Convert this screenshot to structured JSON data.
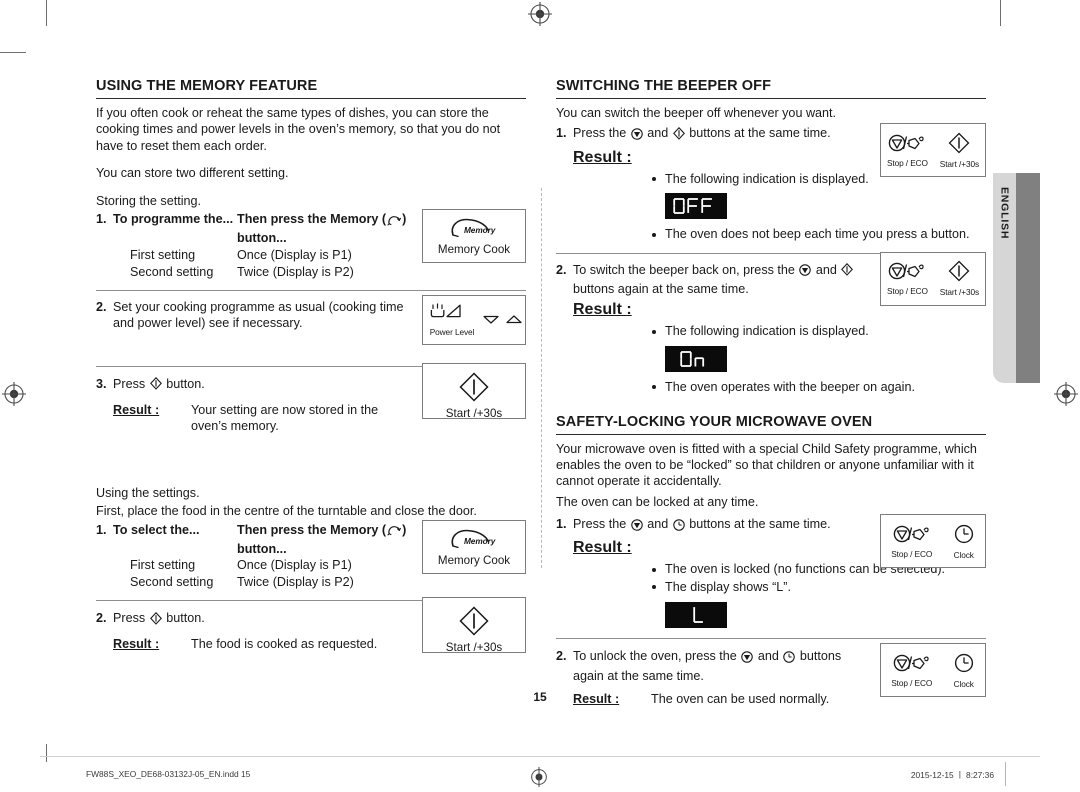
{
  "page": {
    "number": "15",
    "language_tab": "ENGLISH"
  },
  "left_column": {
    "section": {
      "title": "USING THE MEMORY FEATURE",
      "intro_1": "If you often cook or reheat the same types of dishes, you can store the cooking times and power levels in the oven’s memory, so that you do not have to reset them each order.",
      "intro_2": "You can store two different setting."
    },
    "storing": {
      "lead_in": "Storing the setting.",
      "step1": {
        "num": "1.",
        "header_a": "To programme the...",
        "header_b": "Then press the Memory (      ) button...",
        "options": [
          {
            "label": "First setting",
            "action": "Once (Display is P1)"
          },
          {
            "label": "Second setting",
            "action": "Twice (Display is P2)"
          }
        ],
        "keyart": {
          "caption_small": "Memory",
          "caption": "Memory Cook"
        }
      },
      "step2": {
        "num": "2.",
        "text": "Set your cooking programme as usual (cooking time and power level) see if necessary.",
        "keyart": {
          "caption_small": "Power Level"
        }
      },
      "step3": {
        "num": "3.",
        "text_before": "Press",
        "text_after": "button.",
        "result_label": "Result :",
        "result_text": "Your setting are now stored in the oven’s memory.",
        "keyart": {
          "caption": "Start /+30s"
        }
      }
    },
    "using": {
      "lead_in_1": "Using the settings.",
      "lead_in_2": "First, place the food in the centre of the turntable and close the door.",
      "step1": {
        "num": "1.",
        "header_a": "To select the...",
        "header_b": "Then press the Memory (      ) button...",
        "options": [
          {
            "label": "First setting",
            "action": "Once (Display is P1)"
          },
          {
            "label": "Second setting",
            "action": "Twice (Display is P2)"
          }
        ],
        "keyart": {
          "caption_small": "Memory",
          "caption": "Memory Cook"
        }
      },
      "step2": {
        "num": "2.",
        "text_before": "Press",
        "text_after": "button.",
        "result_label": "Result :",
        "result_text": "The food is cooked as requested.",
        "keyart": {
          "caption": "Start /+30s"
        }
      }
    }
  },
  "right_column": {
    "beeper": {
      "title": "SWITCHING THE BEEPER OFF",
      "intro": "You can switch the beeper off whenever you want.",
      "step1": {
        "num": "1.",
        "text_before": "Press the",
        "text_mid": "and",
        "text_after": "buttons at the same time.",
        "result_label": "Result :",
        "bullet_1": "The following indication is displayed.",
        "display_value": "OFF",
        "bullet_2": "The oven does not beep each time you press a button.",
        "keyart": {
          "caption_stop": "Stop / ECO",
          "caption_start": "Start /+30s"
        }
      },
      "step2": {
        "num": "2.",
        "text_before": "To switch the beeper back on, press the",
        "text_mid": "and",
        "text_after": "buttons again at the same time.",
        "result_label": "Result :",
        "bullet_1": "The following indication is displayed.",
        "display_value": "On",
        "bullet_2": "The oven operates with the beeper on again.",
        "keyart": {
          "caption_stop": "Stop / ECO",
          "caption_start": "Start /+30s"
        }
      }
    },
    "safety_lock": {
      "title": "SAFETY-LOCKING YOUR MICROWAVE OVEN",
      "intro_1": "Your microwave oven is fitted with a special Child Safety programme, which enables the oven to be “locked” so that children or anyone unfamiliar with it cannot operate it accidentally.",
      "intro_2": "The oven can be locked at any time.",
      "step1": {
        "num": "1.",
        "text_before": "Press the",
        "text_mid": "and",
        "text_after": "buttons at the same time.",
        "result_label": "Result :",
        "bullet_1": "The oven is locked (no functions can be selected).",
        "bullet_2": "The display shows “L”.",
        "display_value": "L",
        "keyart": {
          "caption_stop": "Stop / ECO",
          "caption_clock": "Clock"
        }
      },
      "step2": {
        "num": "2.",
        "text_before": "To unlock the oven, press the",
        "text_mid": "and",
        "text_after": "buttons",
        "text_line2": "again at the same time.",
        "result_label": "Result :",
        "result_text": "The oven can be used normally.",
        "keyart": {
          "caption_stop": "Stop / ECO",
          "caption_clock": "Clock"
        }
      }
    }
  },
  "footer": {
    "file_name": "FW88S_XEO_DE68-03132J-05_EN.indd   15",
    "timestamp": "2015-12-15   ㅣ 8:27:36"
  }
}
